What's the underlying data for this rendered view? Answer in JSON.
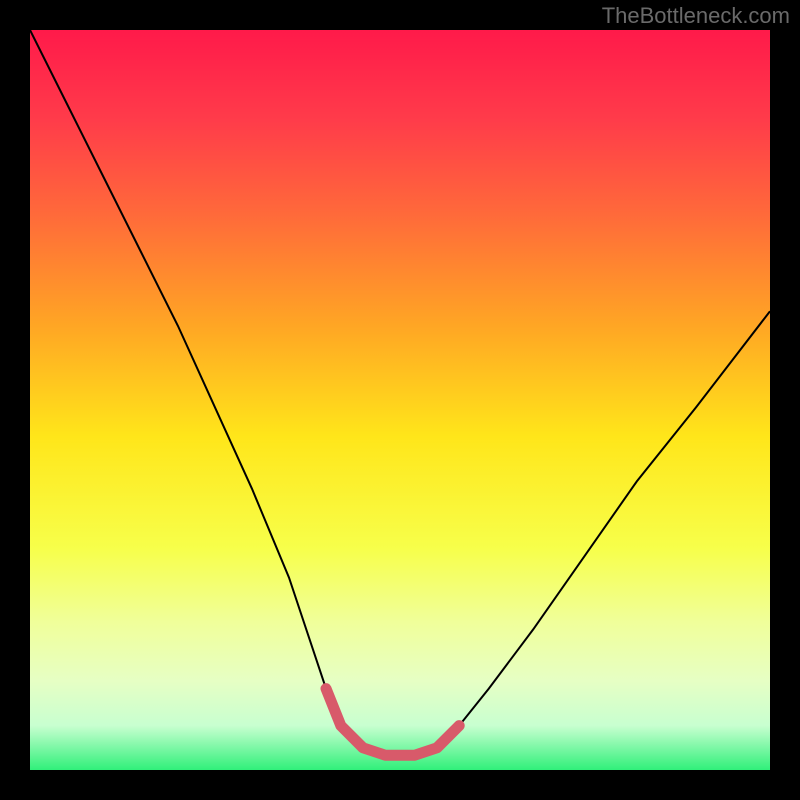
{
  "watermark": "TheBottleneck.com",
  "chart_data": {
    "type": "line",
    "title": "",
    "xlabel": "",
    "ylabel": "",
    "xlim": [
      0,
      100
    ],
    "ylim": [
      0,
      100
    ],
    "grid": false,
    "legend": false,
    "background_gradient": {
      "stops": [
        {
          "offset": 0.0,
          "color": "#ff1a4a"
        },
        {
          "offset": 0.12,
          "color": "#ff3b4a"
        },
        {
          "offset": 0.25,
          "color": "#ff6a3a"
        },
        {
          "offset": 0.4,
          "color": "#ffa624"
        },
        {
          "offset": 0.55,
          "color": "#ffe61a"
        },
        {
          "offset": 0.7,
          "color": "#f7ff4a"
        },
        {
          "offset": 0.8,
          "color": "#f0ff9a"
        },
        {
          "offset": 0.88,
          "color": "#e6ffc4"
        },
        {
          "offset": 0.94,
          "color": "#c8ffd0"
        },
        {
          "offset": 1.0,
          "color": "#30f07a"
        }
      ]
    },
    "series": [
      {
        "name": "score-curve",
        "stroke": "#000000",
        "stroke_width": 2,
        "x": [
          0,
          5,
          10,
          15,
          20,
          25,
          30,
          35,
          38,
          40,
          42,
          45,
          48,
          50,
          52,
          55,
          58,
          62,
          68,
          75,
          82,
          90,
          100
        ],
        "values": [
          100,
          90,
          80,
          70,
          60,
          49,
          38,
          26,
          17,
          11,
          6,
          3,
          2,
          2,
          2,
          3,
          6,
          11,
          19,
          29,
          39,
          49,
          62
        ]
      },
      {
        "name": "sweet-spot-highlight",
        "stroke": "#d85a6a",
        "stroke_width": 11,
        "linecap": "round",
        "x": [
          40,
          42,
          45,
          48,
          50,
          52,
          55,
          58
        ],
        "values": [
          11,
          6,
          3,
          2,
          2,
          2,
          3,
          6
        ]
      }
    ]
  }
}
